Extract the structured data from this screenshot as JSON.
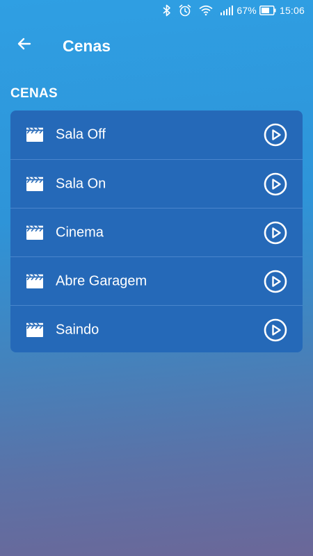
{
  "status_bar": {
    "battery_percent": "67%",
    "time": "15:06",
    "icons": [
      "bluetooth-icon",
      "alarm-icon",
      "wifi-icon",
      "cellular-signal-icon",
      "battery-icon"
    ]
  },
  "app_bar": {
    "title": "Cenas",
    "back_icon": "arrow-left-icon"
  },
  "section": {
    "heading": "CENAS"
  },
  "scenes": [
    {
      "label": "Sala Off",
      "icon": "clapperboard-icon",
      "action_icon": "play-circle-icon"
    },
    {
      "label": "Sala On",
      "icon": "clapperboard-icon",
      "action_icon": "play-circle-icon"
    },
    {
      "label": "Cinema",
      "icon": "clapperboard-icon",
      "action_icon": "play-circle-icon"
    },
    {
      "label": "Abre Garagem",
      "icon": "clapperboard-icon",
      "action_icon": "play-circle-icon"
    },
    {
      "label": "Saindo",
      "icon": "clapperboard-icon",
      "action_icon": "play-circle-icon"
    }
  ],
  "colors": {
    "background_top": "#2f9fe3",
    "background_bottom": "#6b6798",
    "card": "#2569b8",
    "text": "#ffffff"
  }
}
